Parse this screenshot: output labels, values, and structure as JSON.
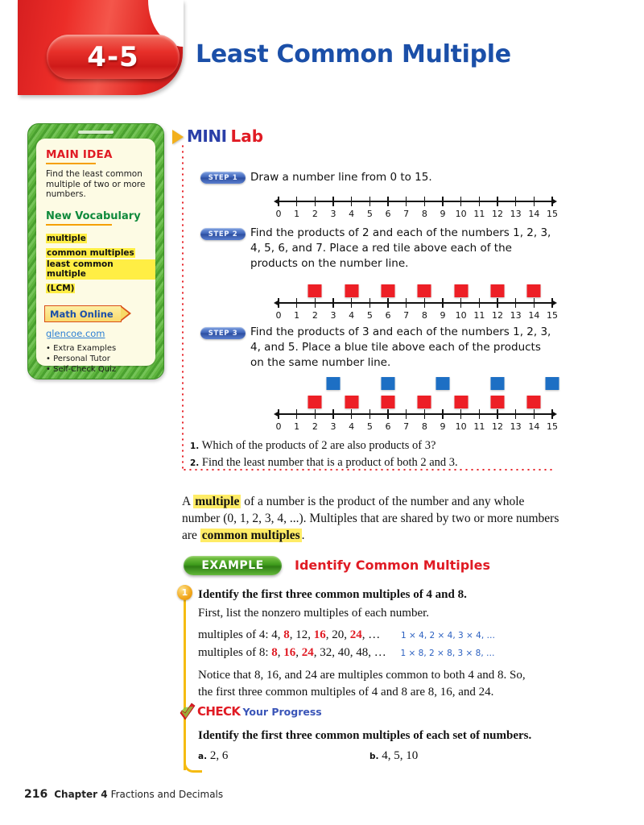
{
  "header": {
    "lesson_number": "4-5",
    "title": "Least Common Multiple"
  },
  "sidebar": {
    "main_idea_heading": "MAIN IDEA",
    "main_idea_body": "Find the least common multiple of two or more numbers.",
    "vocabulary_heading": "New Vocabulary",
    "vocabulary_terms": [
      "multiple",
      "common multiples",
      "least common multiple"
    ],
    "vocabulary_subterm": "(LCM)",
    "math_online_label": "Math Online",
    "website": "glencoe.com",
    "resources": [
      "• Extra Examples",
      "• Personal Tutor",
      "• Self-Check Quiz"
    ]
  },
  "minilab": {
    "heading_part1": "MINI",
    "heading_part2": "Lab",
    "steps": [
      {
        "badge": "STEP 1",
        "text": "Draw a number line from 0 to 15."
      },
      {
        "badge": "STEP 2",
        "text": "Find the products of 2 and each of the numbers 1, 2, 3, 4, 5, 6, and 7. Place a red tile above each of the products on the number line."
      },
      {
        "badge": "STEP 3",
        "text": "Find the products of 3 and each of the numbers 1, 2, 3, 4, and 5. Place a blue tile above each of the products on the same number line."
      }
    ],
    "questions": [
      {
        "number": "1.",
        "text": "Which of the products of 2 are also products of 3?"
      },
      {
        "number": "2.",
        "text": "Find the least number that is a product of both 2 and 3."
      }
    ]
  },
  "chart_data": {
    "type": "line",
    "title": "Number lines 0 to 15 with multiple tiles",
    "axis_min": 0,
    "axis_max": 15,
    "tick_labels": [
      "0",
      "1",
      "2",
      "3",
      "4",
      "5",
      "6",
      "7",
      "8",
      "9",
      "10",
      "11",
      "12",
      "13",
      "14",
      "15"
    ],
    "lines": [
      {
        "id": "step1-number-line",
        "red_tiles": [],
        "blue_tiles": []
      },
      {
        "id": "step2-number-line",
        "red_tiles": [
          2,
          4,
          6,
          8,
          10,
          12,
          14
        ],
        "blue_tiles": []
      },
      {
        "id": "step3-number-line",
        "red_tiles": [
          2,
          4,
          6,
          8,
          10,
          12,
          14
        ],
        "blue_tiles": [
          3,
          6,
          9,
          12,
          15
        ]
      }
    ],
    "red_color": "#ed1f26",
    "blue_color": "#1d6fc4"
  },
  "body": {
    "para_a": "A ",
    "para_hl1": "multiple",
    "para_b": " of a number is the product of the number and any whole number (0, 1, 2, 3, 4, ...). Multiples that are shared by two or more numbers are ",
    "para_hl2": "common multiples",
    "para_c": "."
  },
  "example": {
    "badge": "EXAMPLE",
    "title": "Identify Common Multiples",
    "number": "1",
    "prompt": "Identify the first three common multiples of 4 and 8.",
    "intro": "First, list the nonzero multiples of each number.",
    "row1_label": "multiples of 4:",
    "row1_values": " 4, 8, 12, 16, 20, 24, …",
    "row1_note": "1 × 4, 2 × 4, 3 × 4, …",
    "row2_label": "multiples of 8:",
    "row2_values": " 8, 16, 24, 32, 40, 48, …",
    "row2_note": "1 × 8, 2 × 8, 3 × 8, …",
    "conclusion_line1": "Notice that 8, 16, and 24 are multiples common to both 4 and 8. So,",
    "conclusion_line2": "the first three common multiples of 4 and 8 are 8, 16, and 24."
  },
  "check": {
    "heading_part1": "CHECK",
    "heading_part2": "Your Progress",
    "instruction": "Identify the first three common multiples of each set of numbers.",
    "item_a_label": "a.",
    "item_a_text": "2, 6",
    "item_b_label": "b.",
    "item_b_text": "4, 5, 10"
  },
  "footer": {
    "page": "216",
    "chapter": "Chapter 4",
    "chapter_title": "Fractions and Decimals"
  }
}
